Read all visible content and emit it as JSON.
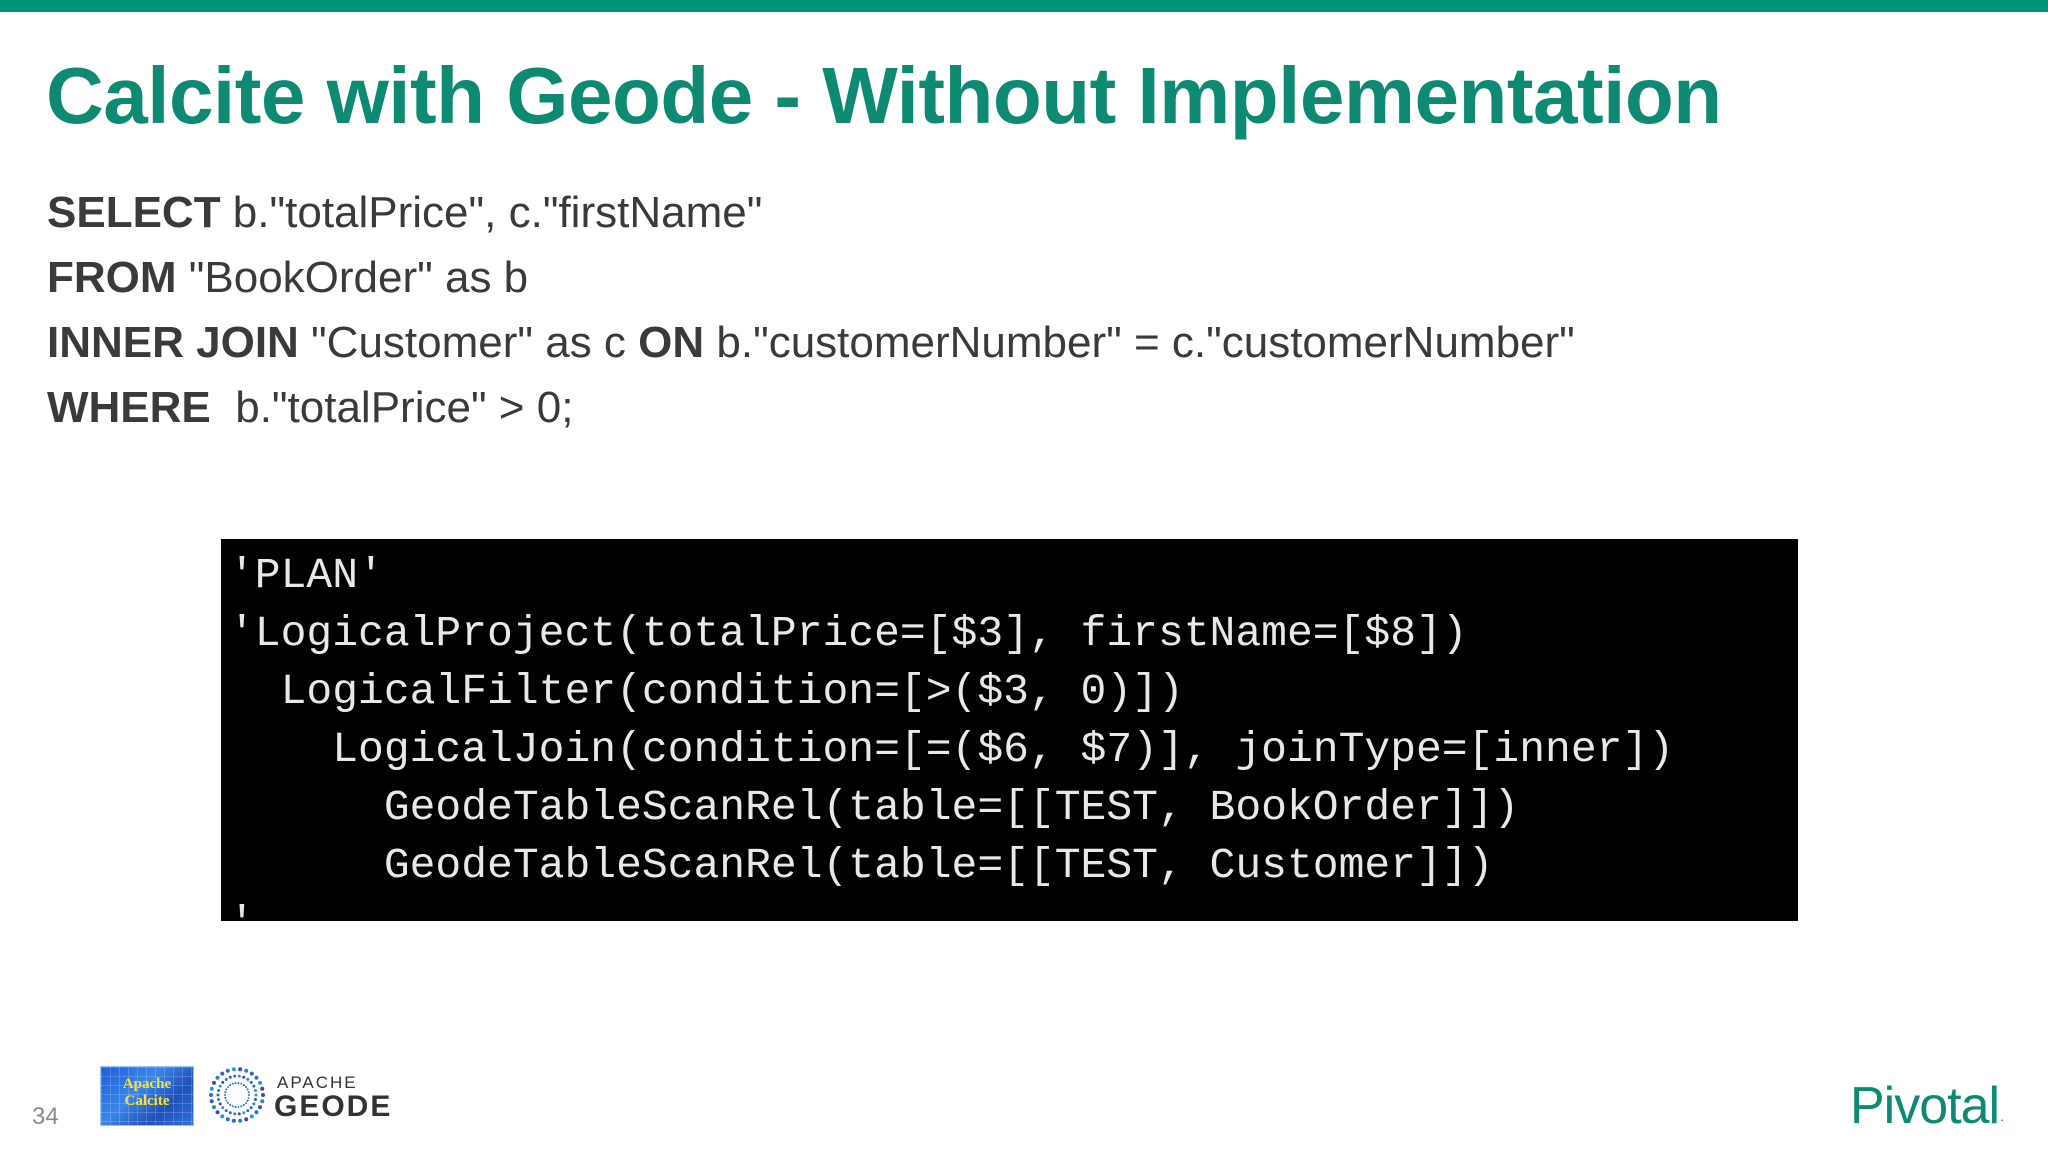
{
  "slide": {
    "title": "Calcite with Geode - Without Implementation",
    "page_number": "34"
  },
  "sql": {
    "lines": [
      {
        "keyword": "SELECT",
        "rest": " b.\"totalPrice\", c.\"firstName\""
      },
      {
        "keyword": "FROM",
        "rest": " \"BookOrder\" as b"
      },
      {
        "keyword": "INNER JOIN",
        "rest": " \"Customer\" as c ",
        "keyword2": "ON",
        "rest2": " b.\"customerNumber\" = c.\"customerNumber\""
      },
      {
        "keyword": "WHERE",
        "rest": "  b.\"totalPrice\" > 0;"
      }
    ]
  },
  "plan": {
    "lines": [
      "'PLAN'",
      "'LogicalProject(totalPrice=[$3], firstName=[$8])",
      "  LogicalFilter(condition=[>($3, 0)])",
      "    LogicalJoin(condition=[=($6, $7)], joinType=[inner])",
      "      GeodeTableScanRel(table=[[TEST, BookOrder]])",
      "      GeodeTableScanRel(table=[[TEST, Customer]])",
      "'"
    ]
  },
  "logos": {
    "calcite_text": "Apache\nCalcite",
    "geode_small": "APACHE",
    "geode_big": "GEODE",
    "pivotal": "Pivotal",
    "pivotal_mark": "."
  },
  "colors": {
    "accent": "#00957b",
    "title": "#0e8a72",
    "body_text": "#3a3a3a",
    "code_bg": "#000000",
    "code_text": "#e8e8e8"
  }
}
